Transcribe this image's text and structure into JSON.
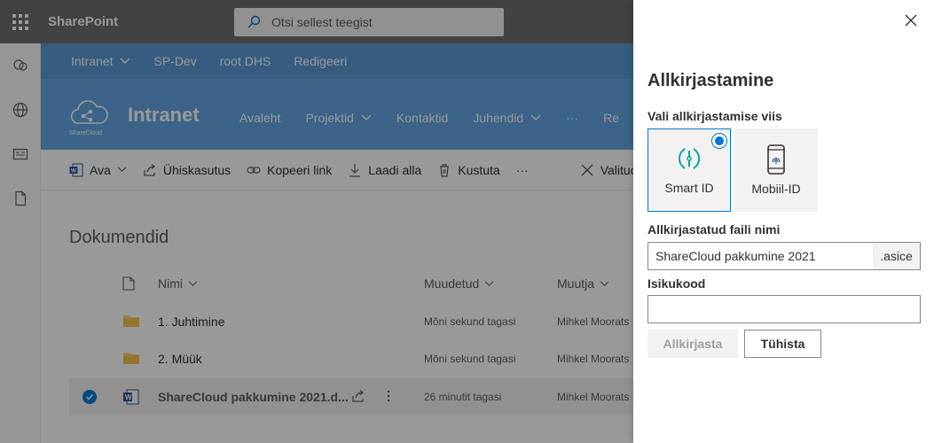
{
  "suitebar": {
    "brand": "SharePoint",
    "search_placeholder": "Otsi sellest teegist"
  },
  "hubnav": {
    "items": [
      "Intranet",
      "SP-Dev",
      "root DHS",
      "Redigeeri"
    ]
  },
  "site": {
    "title": "Intranet",
    "logo_text": "ShareCloud",
    "nav": [
      "Avaleht",
      "Projektid",
      "Kontaktid",
      "Juhendid",
      "···",
      "Re"
    ]
  },
  "commandbar": {
    "open": "Ava",
    "share": "Ühiskasutus",
    "copy_link": "Kopeeri link",
    "download": "Laadi alla",
    "delete": "Kustuta",
    "more": "···",
    "selected": "Valitud"
  },
  "library": {
    "title": "Dokumendid",
    "columns": {
      "name": "Nimi",
      "modified": "Muudetud",
      "modified_by": "Muutja"
    },
    "rows": [
      {
        "name": "1. Juhtimine",
        "modified": "Mõni sekund tagasi",
        "modified_by": "Mihkel Moorats",
        "type": "folder"
      },
      {
        "name": "2. Müük",
        "modified": "Mõni sekund tagasi",
        "modified_by": "Mihkel Moorats",
        "type": "folder"
      },
      {
        "name": "ShareCloud pakkumine 2021.d...",
        "modified": "26 minutit tagasi",
        "modified_by": "Mihkel Moorats",
        "type": "word",
        "selected": true
      }
    ]
  },
  "panel": {
    "title": "Allkirjastamine",
    "method_label": "Vali allkirjastamise viis",
    "methods": [
      {
        "label": "Smart ID",
        "selected": true
      },
      {
        "label": "Mobiil-ID",
        "selected": false
      }
    ],
    "filename_label": "Allkirjastatud faili nimi",
    "filename_value": "ShareCloud pakkumine 2021",
    "filename_suffix": ".asice",
    "idcode_label": "Isikukood",
    "idcode_value": "",
    "sign_button": "Allkirjasta",
    "cancel_button": "Tühista"
  },
  "colors": {
    "accent": "#0078d4",
    "hub": "#5a9bd5",
    "header": "#63a7e3",
    "suitebar": "#6e6e6e"
  }
}
